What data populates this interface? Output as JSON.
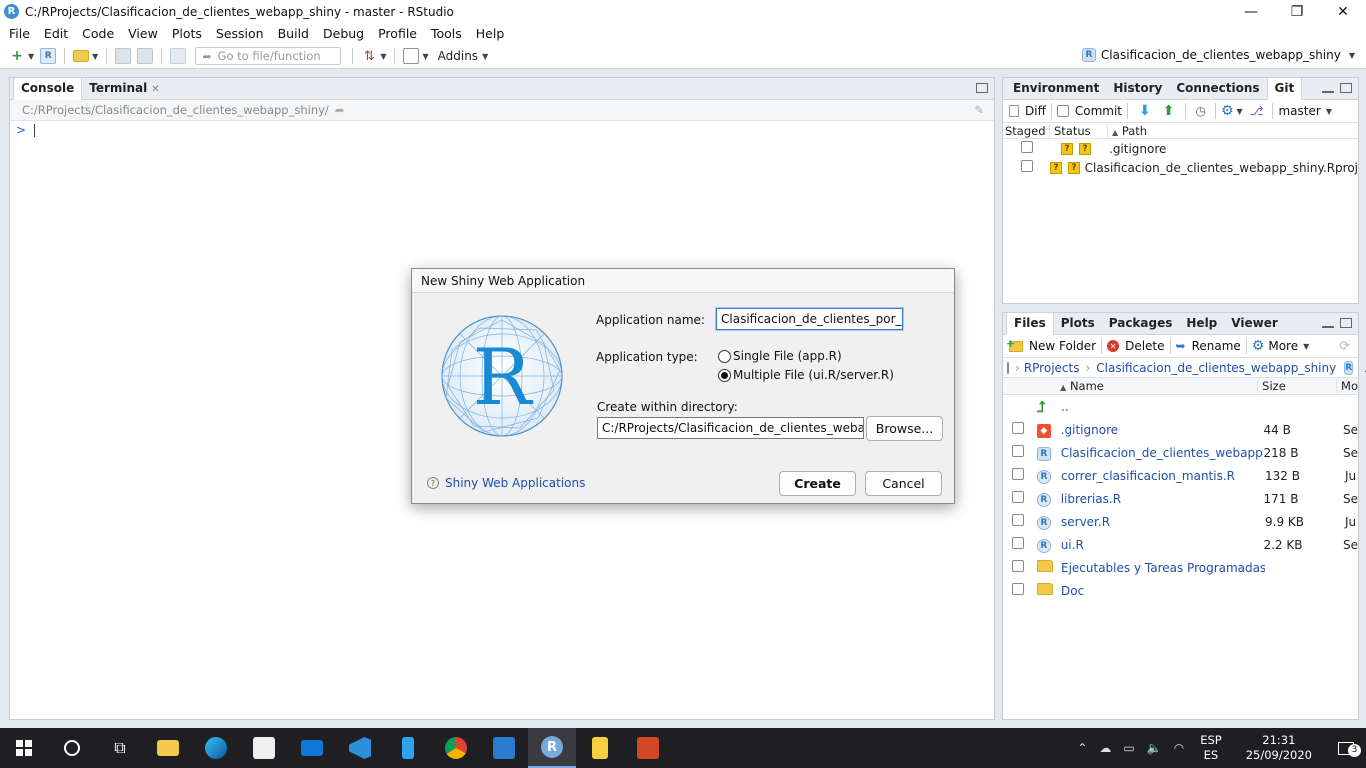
{
  "window": {
    "title": "C:/RProjects/Clasificacion_de_clientes_webapp_shiny - master - RStudio",
    "minimize": "—",
    "maximize": "❐",
    "close": "✕"
  },
  "menu": [
    "File",
    "Edit",
    "Code",
    "View",
    "Plots",
    "Session",
    "Build",
    "Debug",
    "Profile",
    "Tools",
    "Help"
  ],
  "toolbar": {
    "goto_placeholder": "Go to file/function",
    "addins": "Addins",
    "project": "Clasificacion_de_clientes_webapp_shiny"
  },
  "console_pane": {
    "tabs": [
      "Console",
      "Terminal"
    ],
    "path": "C:/RProjects/Clasificacion_de_clientes_webapp_shiny/",
    "prompt": ">"
  },
  "git_pane": {
    "tabs": [
      "Environment",
      "History",
      "Connections",
      "Git"
    ],
    "active_tab": "Git",
    "diff": "Diff",
    "commit": "Commit",
    "branch": "master",
    "columns": [
      "Staged",
      "Status",
      "Path"
    ],
    "rows": [
      {
        "path": ".gitignore",
        "status": "?"
      },
      {
        "path": "Clasificacion_de_clientes_webapp_shiny.Rproj",
        "status": "?"
      }
    ]
  },
  "files_pane": {
    "tabs": [
      "Files",
      "Plots",
      "Packages",
      "Help",
      "Viewer"
    ],
    "active_tab": "Files",
    "new_folder": "New Folder",
    "delete": "Delete",
    "rename": "Rename",
    "more": "More",
    "breadcrumb": [
      "RProjects",
      "Clasificacion_de_clientes_webapp_shiny"
    ],
    "breadcrumb_more": "...",
    "columns": [
      "Name",
      "Size",
      "Mo"
    ],
    "parent": "..",
    "files": [
      {
        "name": ".gitignore",
        "size": "44 B",
        "mod": "Se",
        "icon": "git-icon"
      },
      {
        "name": "Clasificacion_de_clientes_webapp_s...",
        "size": "218 B",
        "mod": "Se",
        "icon": "rproj-icon"
      },
      {
        "name": "correr_clasificacion_mantis.R",
        "size": "132 B",
        "mod": "Ju",
        "icon": "r-file-icon"
      },
      {
        "name": "librerias.R",
        "size": "171 B",
        "mod": "Se",
        "icon": "r-file-icon"
      },
      {
        "name": "server.R",
        "size": "9.9 KB",
        "mod": "Ju",
        "icon": "r-file-icon"
      },
      {
        "name": "ui.R",
        "size": "2.2 KB",
        "mod": "Se",
        "icon": "r-file-icon"
      },
      {
        "name": "Ejecutables y Tareas Programadas",
        "size": "",
        "mod": "",
        "icon": "folder-icon"
      },
      {
        "name": "Doc",
        "size": "",
        "mod": "",
        "icon": "folder-icon"
      }
    ]
  },
  "dialog": {
    "title": "New Shiny Web Application",
    "app_name_label": "Application name:",
    "app_name_value": "Clasificacion_de_clientes_por_tiempo",
    "app_type_label": "Application type:",
    "single_file": "Single File (app.R)",
    "multiple_file": "Multiple File (ui.R/server.R)",
    "selected_type": "multiple",
    "directory_label": "Create within directory:",
    "directory_value": "C:/RProjects/Clasificacion_de_clientes_webapp_shiny",
    "browse": "Browse...",
    "help_link": "Shiny Web Applications",
    "create": "Create",
    "cancel": "Cancel",
    "logo_letter": "R"
  },
  "taskbar": {
    "lang_top": "ESP",
    "lang_bottom": "ES",
    "time": "21:31",
    "date": "25/09/2020",
    "notifications": "3"
  }
}
